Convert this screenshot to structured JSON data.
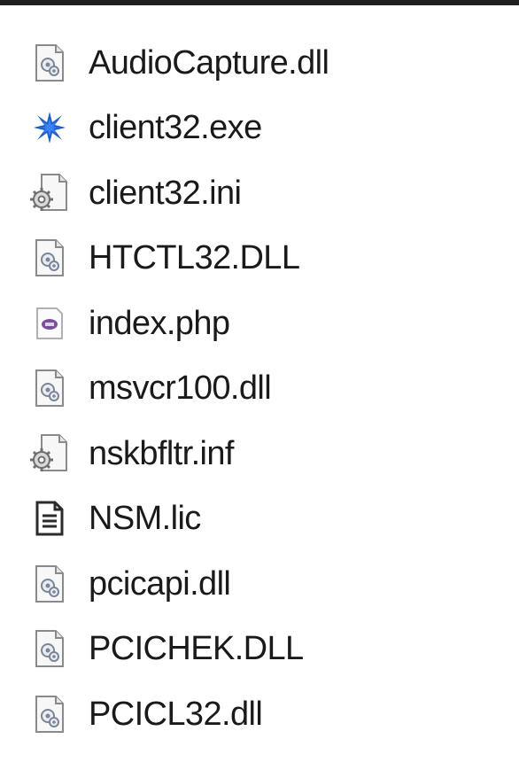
{
  "files": [
    {
      "name": "AudioCapture.dll",
      "icon": "dll-file-icon"
    },
    {
      "name": "client32.exe",
      "icon": "exe-app-icon"
    },
    {
      "name": "client32.ini",
      "icon": "settings-file-icon"
    },
    {
      "name": "HTCTL32.DLL",
      "icon": "dll-file-icon"
    },
    {
      "name": "index.php",
      "icon": "php-file-icon"
    },
    {
      "name": "msvcr100.dll",
      "icon": "dll-file-icon"
    },
    {
      "name": "nskbfltr.inf",
      "icon": "settings-file-icon"
    },
    {
      "name": "NSM.lic",
      "icon": "text-document-icon"
    },
    {
      "name": "pcicapi.dll",
      "icon": "dll-file-icon"
    },
    {
      "name": "PCICHEK.DLL",
      "icon": "dll-file-icon"
    },
    {
      "name": "PCICL32.dll",
      "icon": "dll-file-icon"
    }
  ],
  "colors": {
    "exe_icon": "#1e5fc8",
    "php_icon": "#7b4fa0",
    "border": "#1f1f1f"
  }
}
